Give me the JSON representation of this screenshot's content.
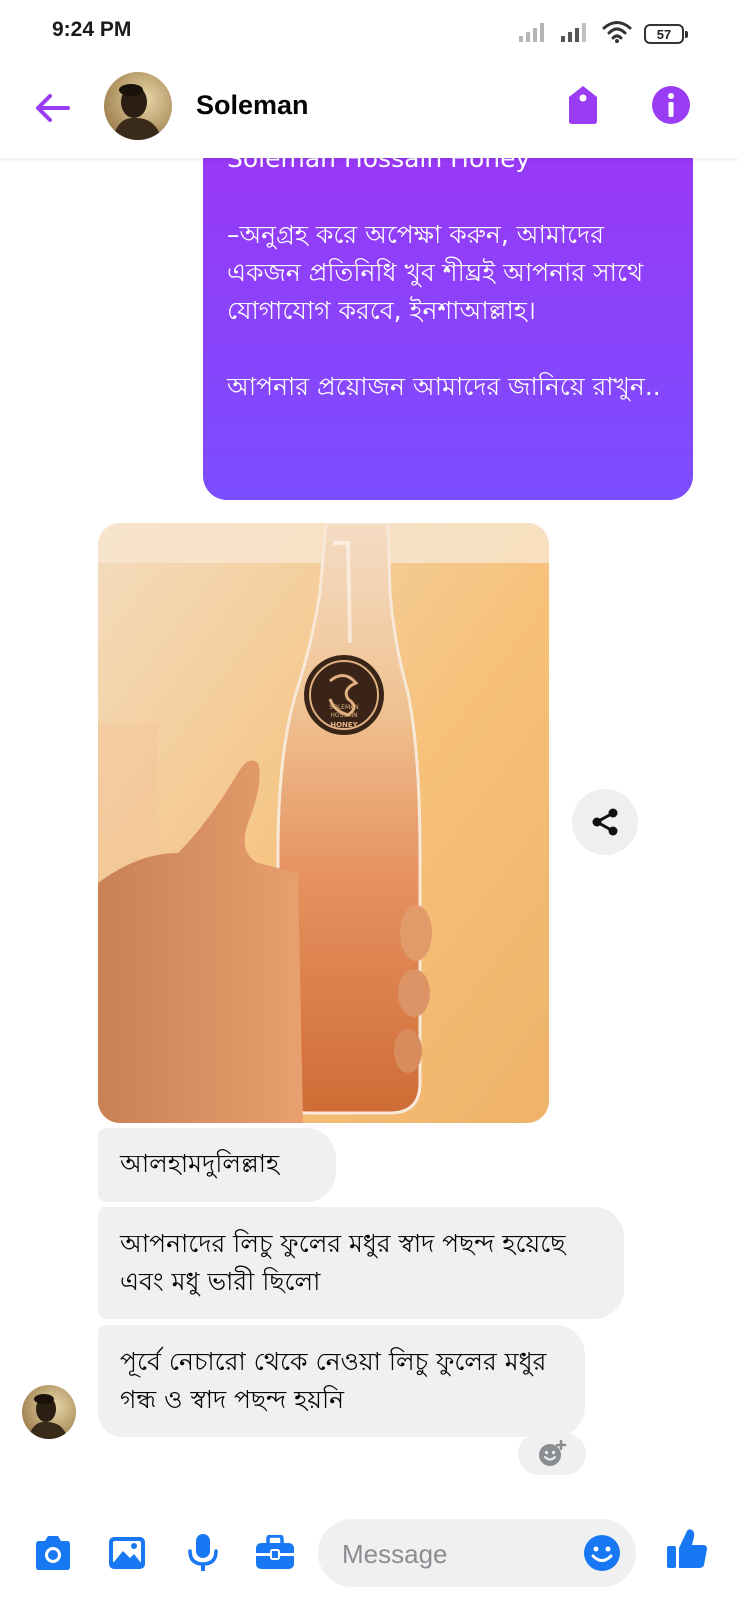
{
  "status_bar": {
    "time": "9:24 PM",
    "battery": "57"
  },
  "header": {
    "contact_name": "Soleman"
  },
  "messages": {
    "outgoing_text": "Soleman Hossain Honey\n\n–অনুগ্রহ করে অপেক্ষা করুন, আমাদের একজন প্রতিনিধি খুব শীঘ্রই আপনার সাথে যোগাযোগ করবে, ইনশাআল্লাহ।\n\nআপনার প্রয়োজন আমাদের জানিয়ে রাখুন..",
    "photo_label_line1": "SOLEMAN",
    "photo_label_line2": "HOSSAIN",
    "photo_label_line3": "HONEY",
    "incoming": [
      "আলহামদুলিল্লাহ",
      "আপনাদের লিচু ফুলের মধুর স্বাদ পছন্দ হয়েছে এবং মধু ভারী ছিলো",
      "পূর্বে নেচারো থেকে নেওয়া লিচু ফুলের মধুর গন্ধ ও স্বাদ পছন্দ হয়নি"
    ]
  },
  "composer": {
    "placeholder": "Message"
  },
  "colors": {
    "accent": "#9b3cf5",
    "bubble_out_top": "#9b36f5",
    "bubble_out_bottom": "#7b4dff",
    "bubble_in": "#f0f0f0",
    "composer_blue": "#1877f2"
  },
  "icons": {
    "back": "back-arrow-icon",
    "tag": "tag-icon",
    "info": "info-icon",
    "share": "share-icon",
    "reaction": "add-reaction-icon",
    "camera": "camera-icon",
    "gallery": "image-icon",
    "mic": "microphone-icon",
    "business": "briefcase-icon",
    "emoji": "emoji-icon",
    "like": "thumbs-up-icon"
  }
}
